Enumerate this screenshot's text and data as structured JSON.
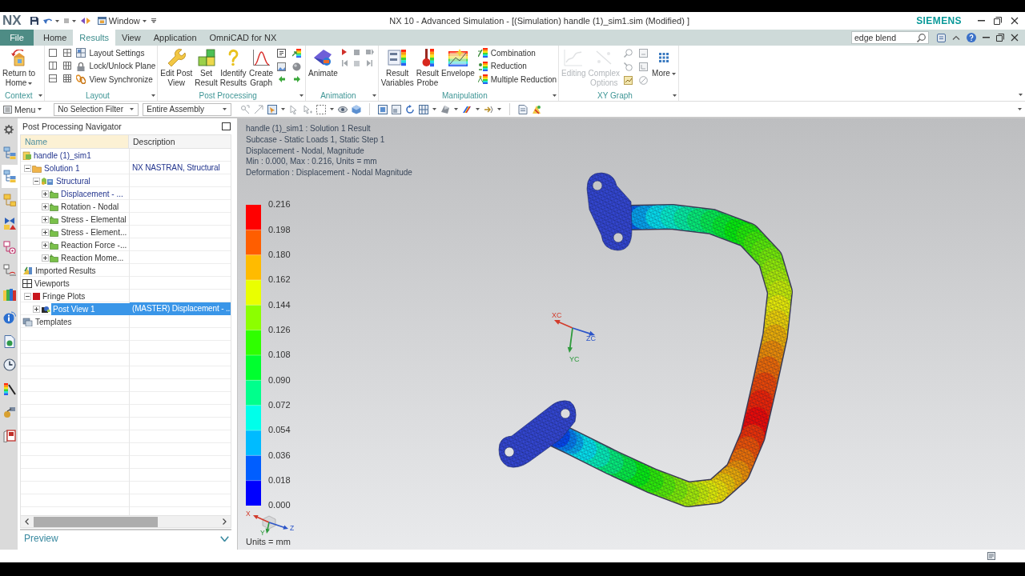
{
  "title_bar": {
    "logo": "NX",
    "window_menu": "Window",
    "title": "NX 10 - Advanced Simulation - [(Simulation) handle (1)_sim1.sim (Modified) ]",
    "brand": "SIEMENS"
  },
  "ribbon": {
    "file_tab": "File",
    "tabs": [
      {
        "label": "Home",
        "selected": false
      },
      {
        "label": "Results",
        "selected": true
      },
      {
        "label": "View",
        "selected": false
      },
      {
        "label": "Application",
        "selected": false
      },
      {
        "label": "OmniCAD for NX",
        "selected": false
      }
    ],
    "search": {
      "value": "edge blend"
    },
    "groups": [
      {
        "label": "Context",
        "items": [
          {
            "kind": "large",
            "label": "Return to\nHome",
            "dropdown": true,
            "disabled": false
          }
        ]
      },
      {
        "label": "Layout",
        "items": [
          {
            "kind": "layout_icons"
          },
          {
            "kind": "list",
            "items": [
              {
                "label": "Layout Settings"
              },
              {
                "label": "Lock/Unlock Plane"
              },
              {
                "label": "View Synchronize"
              }
            ]
          }
        ]
      },
      {
        "label": "Post Processing",
        "items": [
          {
            "kind": "large",
            "label": "Edit Post\nView",
            "dropdown": false,
            "disabled": false
          },
          {
            "kind": "large",
            "label": "Set\nResult",
            "dropdown": false,
            "disabled": false
          },
          {
            "kind": "large",
            "label": "Identify\nResults",
            "dropdown": false,
            "disabled": false
          },
          {
            "kind": "large",
            "label": "Create\nGraph",
            "dropdown": false,
            "disabled": false
          },
          {
            "kind": "post_icons"
          }
        ]
      },
      {
        "label": "Animation",
        "items": [
          {
            "kind": "large",
            "label": "Animate",
            "dropdown": false,
            "disabled": false
          },
          {
            "kind": "playback_icons"
          }
        ]
      },
      {
        "label": "Manipulation",
        "items": [
          {
            "kind": "large",
            "label": "Result\nVariables",
            "dropdown": false,
            "disabled": false
          },
          {
            "kind": "large",
            "label": "Result\nProbe",
            "dropdown": false,
            "disabled": false
          },
          {
            "kind": "large",
            "label": "Envelope",
            "dropdown": false,
            "disabled": false
          },
          {
            "kind": "list",
            "items": [
              {
                "label": "Combination"
              },
              {
                "label": "Reduction"
              },
              {
                "label": "Multiple Reduction"
              }
            ]
          }
        ]
      },
      {
        "label": "XY Graph",
        "items": [
          {
            "kind": "large",
            "label": "Editing",
            "dropdown": false,
            "disabled": true
          },
          {
            "kind": "large",
            "label": "Complex\nOptions",
            "dropdown": false,
            "disabled": true
          },
          {
            "kind": "xy_icons"
          },
          {
            "kind": "large",
            "label": "More",
            "dropdown": true,
            "disabled": false
          }
        ]
      }
    ]
  },
  "toolbar": {
    "menu": "Menu",
    "selection_filter": "No Selection Filter",
    "assembly_scope": "Entire Assembly"
  },
  "resource_bar": [
    {
      "kind": "tree",
      "selected": false
    },
    {
      "kind": "tree",
      "selected": true
    },
    {
      "kind": "groups",
      "selected": false
    },
    {
      "kind": "constraints",
      "selected": false
    },
    {
      "kind": "nodes",
      "selected": false
    },
    {
      "kind": "diagram",
      "selected": false
    },
    {
      "kind": "library",
      "selected": false
    },
    {
      "kind": "info",
      "selected": false
    },
    {
      "kind": "document",
      "selected": false
    },
    {
      "kind": "history",
      "selected": false
    },
    {
      "kind": "fringe",
      "selected": false
    },
    {
      "kind": "roles",
      "selected": false
    },
    {
      "kind": "template",
      "selected": false
    }
  ],
  "navigator": {
    "title": "Post Processing Navigator",
    "columns": [
      {
        "label": "Name",
        "highlighted": true
      },
      {
        "label": "Description",
        "highlighted": false
      }
    ],
    "tree": [
      {
        "kind": "sim",
        "label": "handle (1)_sim1",
        "active": true,
        "selected": false,
        "children": [
          {
            "kind": "solution",
            "label": "Solution 1",
            "description": "NX NASTRAN, Structural",
            "expanded": true,
            "active": true,
            "selected": false,
            "children": [
              {
                "kind": "structural",
                "label": "Structural",
                "expanded": true,
                "active": true,
                "selected": false,
                "children": [
                  {
                    "kind": "result",
                    "label": "Displacement - ...",
                    "expanded": false,
                    "active": true,
                    "selected": false
                  },
                  {
                    "kind": "result",
                    "label": "Rotation - Nodal",
                    "expanded": false,
                    "active": false,
                    "selected": false
                  },
                  {
                    "kind": "result",
                    "label": "Stress - Elemental",
                    "expanded": false,
                    "active": false,
                    "selected": false
                  },
                  {
                    "kind": "result",
                    "label": "Stress - Element...",
                    "expanded": false,
                    "active": false,
                    "selected": false
                  },
                  {
                    "kind": "result",
                    "label": "Reaction Force -...",
                    "expanded": false,
                    "active": false,
                    "selected": false
                  },
                  {
                    "kind": "result",
                    "label": "Reaction Mome...",
                    "expanded": false,
                    "active": false,
                    "selected": false
                  }
                ]
              }
            ]
          }
        ]
      },
      {
        "kind": "imported",
        "label": "Imported Results",
        "active": false,
        "selected": false
      },
      {
        "kind": "viewports",
        "label": "Viewports",
        "active": false,
        "selected": false,
        "children": [
          {
            "kind": "fringe",
            "label": "Fringe Plots",
            "expanded": true,
            "active": false,
            "selected": false,
            "children": [
              {
                "kind": "postview",
                "label": "Post View 1",
                "description": "(MASTER) Displacement - ...",
                "expanded": false,
                "active": false,
                "selected": true
              }
            ]
          }
        ]
      },
      {
        "kind": "templates",
        "label": "Templates",
        "active": false,
        "selected": false
      }
    ],
    "preview": "Preview"
  },
  "viewport": {
    "info": [
      "handle (1)_sim1 : Solution 1 Result",
      "Subcase - Static Loads 1, Static Step 1",
      "Displacement - Nodal, Magnitude",
      "Min : 0.000, Max : 0.216, Units = mm",
      "Deformation : Displacement - Nodal Magnitude"
    ],
    "legend": {
      "values": [
        "0.216",
        "0.198",
        "0.180",
        "0.162",
        "0.144",
        "0.126",
        "0.108",
        "0.090",
        "0.072",
        "0.054",
        "0.036",
        "0.018",
        "0.000"
      ],
      "units": "Units = mm"
    },
    "mini_triad": [
      {
        "label": "X",
        "color": "#d23c2c"
      },
      {
        "label": "Y",
        "color": "#2e9a3c"
      },
      {
        "label": "Z",
        "color": "#2c55c8"
      }
    ],
    "triad": [
      {
        "label": "XC",
        "color": "#d23c2c"
      },
      {
        "label": "YC",
        "color": "#2e9a3c"
      },
      {
        "label": "ZC",
        "color": "#2c55c8"
      }
    ]
  }
}
